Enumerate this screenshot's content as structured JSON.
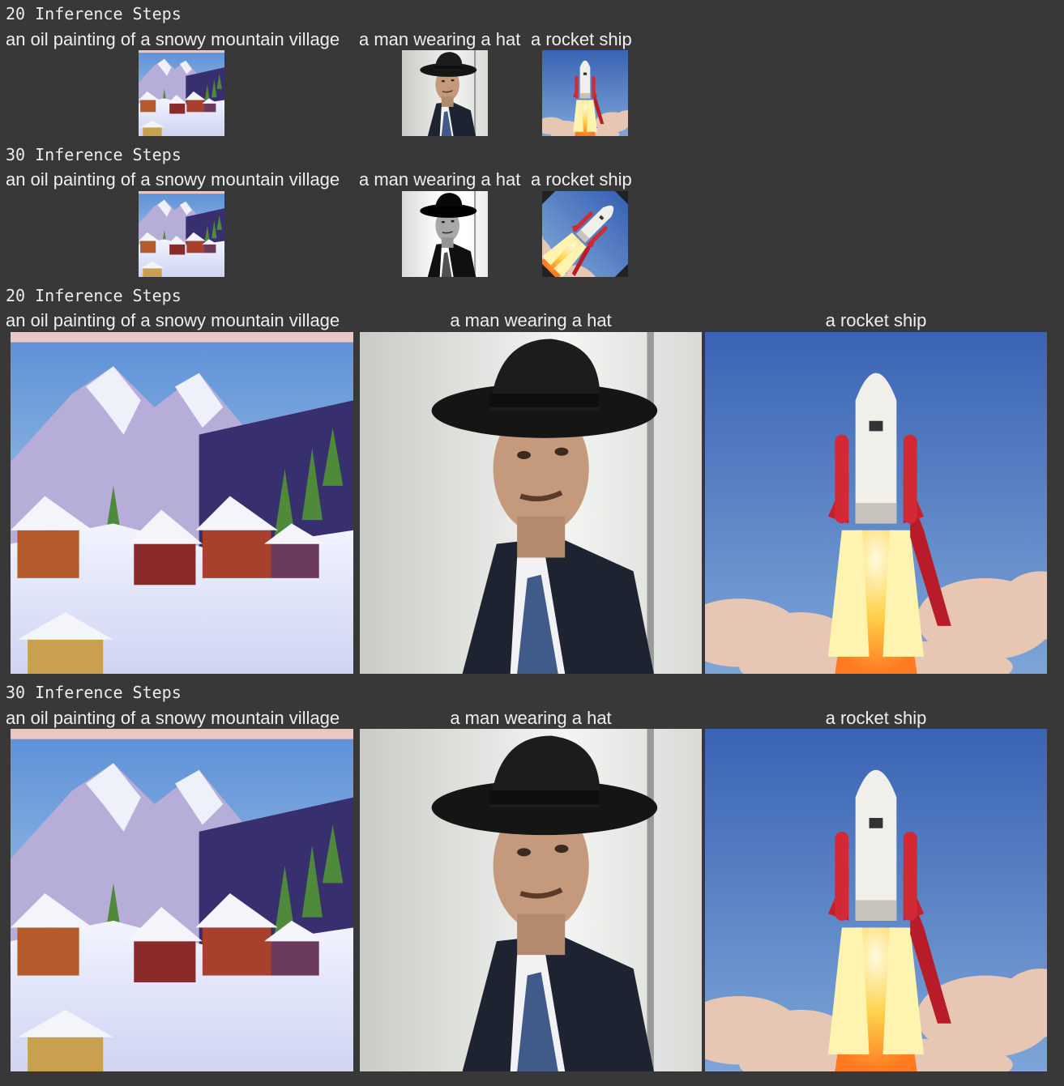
{
  "sections": [
    {
      "heading": "20 Inference Steps",
      "captions": [
        "an oil painting of a snowy mountain village",
        "a man wearing a hat",
        "a rocket ship"
      ]
    },
    {
      "heading": "30 Inference Steps",
      "captions": [
        "an oil painting of a snowy mountain village",
        "a man wearing a hat",
        "a rocket ship"
      ]
    },
    {
      "heading": "20 Inference Steps",
      "captions": [
        "an oil painting of a snowy mountain village",
        "a man wearing a hat",
        "a rocket ship"
      ]
    },
    {
      "heading": "30 Inference Steps",
      "captions": [
        "an oil painting of a snowy mountain village",
        "a man wearing a hat",
        "a rocket ship"
      ]
    }
  ],
  "images": [
    "snowy-village-painting",
    "man-in-hat-portrait",
    "rocket-launch"
  ],
  "colors": {
    "background": "#383838",
    "text": "#e6e6e6",
    "sky": "#4a78c4",
    "rocket_red": "#c8202a"
  }
}
